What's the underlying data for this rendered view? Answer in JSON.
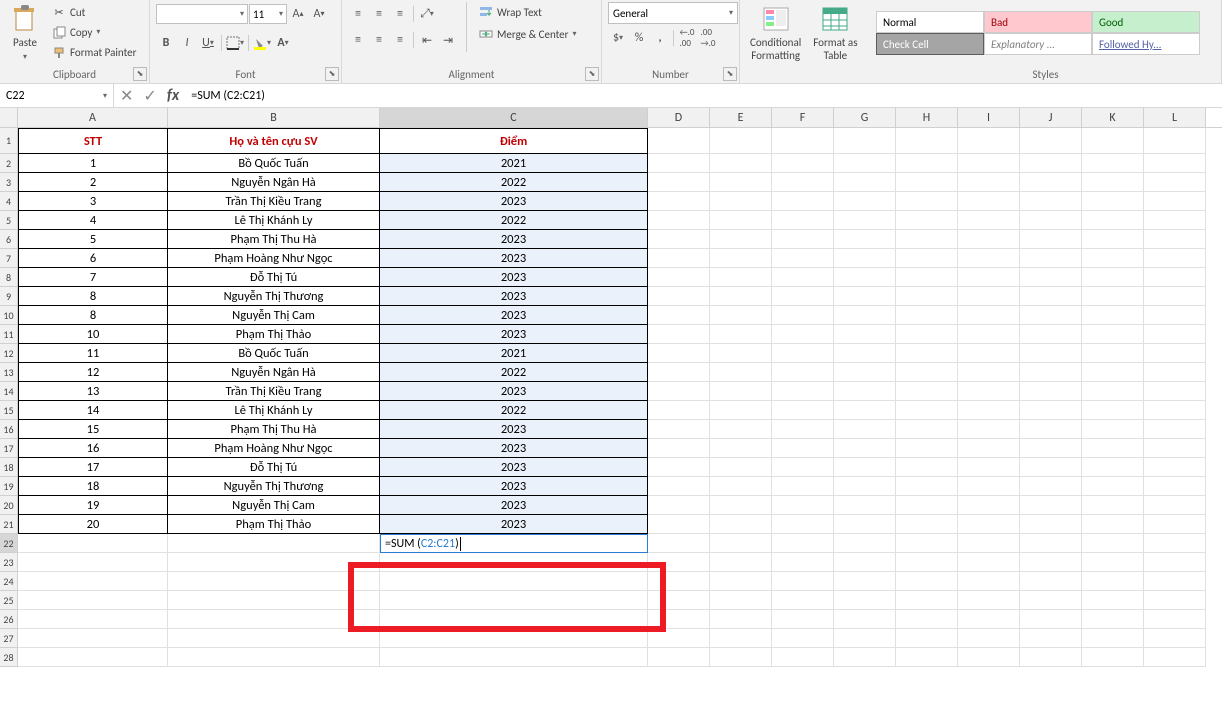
{
  "ribbon": {
    "clipboard": {
      "paste": "Paste",
      "cut": "Cut",
      "copy": "Copy",
      "painter": "Format Painter",
      "label": "Clipboard"
    },
    "font": {
      "name": "",
      "size": "11",
      "label": "Font"
    },
    "alignment": {
      "wrap": "Wrap Text",
      "merge": "Merge & Center",
      "label": "Alignment"
    },
    "number": {
      "format": "General",
      "label": "Number"
    },
    "conditional": "Conditional\nFormatting",
    "fmtTable": "Format as\nTable",
    "styles": {
      "normal": "Normal",
      "bad": "Bad",
      "good": "Good",
      "check": "Check Cell",
      "explan": "Explanatory ...",
      "hyper": "Followed Hy...",
      "label": "Styles"
    }
  },
  "namebox": "C22",
  "formula": "=SUM (C2:C21)",
  "formula_pre": "=SUM (",
  "formula_ref": "C2:C21",
  "formula_post": ")",
  "columns": [
    "A",
    "B",
    "C",
    "D",
    "E",
    "F",
    "G",
    "H",
    "I",
    "J",
    "K",
    "L"
  ],
  "headers": {
    "stt": "STT",
    "name": "Họ và tên cựu SV",
    "score": "Điểm"
  },
  "data": [
    {
      "stt": "1",
      "name": "Bồ Quốc Tuấn",
      "score": "2021"
    },
    {
      "stt": "2",
      "name": "Nguyễn Ngân Hà",
      "score": "2022"
    },
    {
      "stt": "3",
      "name": "Trần Thị Kiều Trang",
      "score": "2023"
    },
    {
      "stt": "4",
      "name": "Lê Thị Khánh Ly",
      "score": "2022"
    },
    {
      "stt": "5",
      "name": "Phạm Thị Thu Hà",
      "score": "2023"
    },
    {
      "stt": "6",
      "name": "Phạm Hoàng Như Ngọc",
      "score": "2023"
    },
    {
      "stt": "7",
      "name": "Đỗ Thị Tú",
      "score": "2023"
    },
    {
      "stt": "8",
      "name": "Nguyễn Thị Thương",
      "score": "2023"
    },
    {
      "stt": "8",
      "name": "Nguyễn Thị Cam",
      "score": "2023"
    },
    {
      "stt": "10",
      "name": "Phạm Thị Thảo",
      "score": "2023"
    },
    {
      "stt": "11",
      "name": "Bồ Quốc Tuấn",
      "score": "2021"
    },
    {
      "stt": "12",
      "name": "Nguyễn Ngân Hà",
      "score": "2022"
    },
    {
      "stt": "13",
      "name": "Trần Thị Kiều Trang",
      "score": "2023"
    },
    {
      "stt": "14",
      "name": "Lê Thị Khánh Ly",
      "score": "2022"
    },
    {
      "stt": "15",
      "name": "Phạm Thị Thu Hà",
      "score": "2023"
    },
    {
      "stt": "16",
      "name": "Phạm Hoàng Như Ngọc",
      "score": "2023"
    },
    {
      "stt": "17",
      "name": "Đỗ Thị Tú",
      "score": "2023"
    },
    {
      "stt": "18",
      "name": "Nguyễn Thị Thương",
      "score": "2023"
    },
    {
      "stt": "19",
      "name": "Nguyễn Thị Cam",
      "score": "2023"
    },
    {
      "stt": "20",
      "name": "Phạm Thị Thảo",
      "score": "2023"
    }
  ],
  "emptyRows": [
    23,
    24,
    25,
    26,
    27,
    28
  ]
}
